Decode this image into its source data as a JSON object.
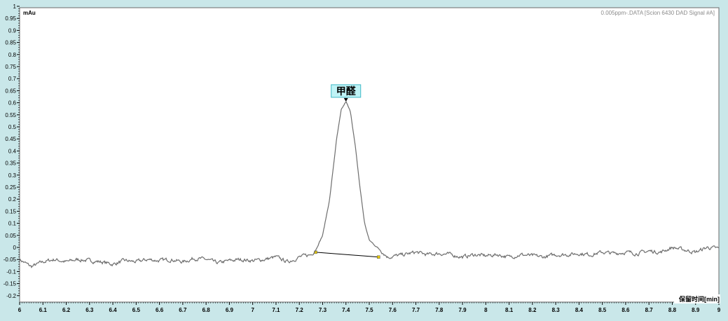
{
  "window": {
    "background_color": "#c9e7e9",
    "plot_background_color": "#ffffff",
    "trace_color": "#6e6e6e",
    "label_fill_color": "#bff3f6",
    "label_border_color": "#3fb8c6"
  },
  "chart_data": {
    "type": "line",
    "title": "0.005ppm-.DATA [Scion 6430 DAD Signal #A]",
    "ylabel": "mAu",
    "xlabel": "保留时间[min]",
    "xlim": [
      6,
      9
    ],
    "ylim": [
      -0.22,
      1.0
    ],
    "grid": false,
    "x_ticks": [
      "6",
      "6.1",
      "6.2",
      "6.3",
      "6.4",
      "6.5",
      "6.6",
      "6.7",
      "6.8",
      "6.9",
      "7",
      "7.1",
      "7.2",
      "7.3",
      "7.4",
      "7.5",
      "7.6",
      "7.7",
      "7.8",
      "7.9",
      "8",
      "8.1",
      "8.2",
      "8.3",
      "8.4",
      "8.5",
      "8.6",
      "8.7",
      "8.8",
      "8.9",
      "9"
    ],
    "y_ticks": [
      "1",
      "0.95",
      "0.9",
      "0.85",
      "0.8",
      "0.75",
      "0.7",
      "0.65",
      "0.6",
      "0.55",
      "0.5",
      "0.45",
      "0.4",
      "0.35",
      "0.3",
      "0.25",
      "0.2",
      "0.15",
      "0.1",
      "0.05",
      "0",
      "-0.05",
      "-0.1",
      "-0.15",
      "-0.2"
    ],
    "series": [
      {
        "x": [
          6.0,
          6.05,
          6.1,
          6.15,
          6.2,
          6.25,
          6.3,
          6.35,
          6.4,
          6.45,
          6.5,
          6.55,
          6.6,
          6.65,
          6.7,
          6.75,
          6.8,
          6.85,
          6.9,
          6.95,
          7.0,
          7.05,
          7.1,
          7.15,
          7.2,
          7.25,
          7.27,
          7.3,
          7.33,
          7.36,
          7.38,
          7.4,
          7.42,
          7.44,
          7.46,
          7.48,
          7.5,
          7.54,
          7.58,
          7.65,
          7.7,
          7.75,
          7.8,
          7.85,
          7.9,
          7.95,
          8.0,
          8.05,
          8.1,
          8.15,
          8.2,
          8.25,
          8.3,
          8.35,
          8.4,
          8.45,
          8.5,
          8.55,
          8.6,
          8.65,
          8.7,
          8.75,
          8.8,
          8.85,
          8.9,
          8.95,
          9.0
        ],
        "y": [
          -0.05,
          -0.08,
          -0.06,
          -0.05,
          -0.06,
          -0.05,
          -0.055,
          -0.06,
          -0.07,
          -0.055,
          -0.06,
          -0.05,
          -0.055,
          -0.05,
          -0.06,
          -0.045,
          -0.05,
          -0.065,
          -0.055,
          -0.05,
          -0.055,
          -0.05,
          -0.04,
          -0.06,
          -0.04,
          -0.03,
          -0.01,
          0.05,
          0.2,
          0.45,
          0.57,
          0.605,
          0.56,
          0.42,
          0.25,
          0.1,
          0.03,
          -0.005,
          -0.04,
          -0.03,
          -0.02,
          -0.03,
          -0.025,
          -0.03,
          -0.04,
          -0.03,
          -0.035,
          -0.03,
          -0.04,
          -0.03,
          -0.035,
          -0.04,
          -0.03,
          -0.03,
          -0.025,
          -0.03,
          -0.02,
          -0.025,
          -0.02,
          -0.025,
          -0.015,
          -0.02,
          0.0,
          -0.01,
          -0.02,
          0.0,
          -0.005
        ]
      }
    ],
    "baseline": {
      "x": [
        7.27,
        7.54
      ],
      "y": [
        -0.02,
        -0.04
      ]
    },
    "peaks": [
      {
        "label": "甲醛",
        "x": 7.4,
        "y": 0.605
      }
    ]
  }
}
